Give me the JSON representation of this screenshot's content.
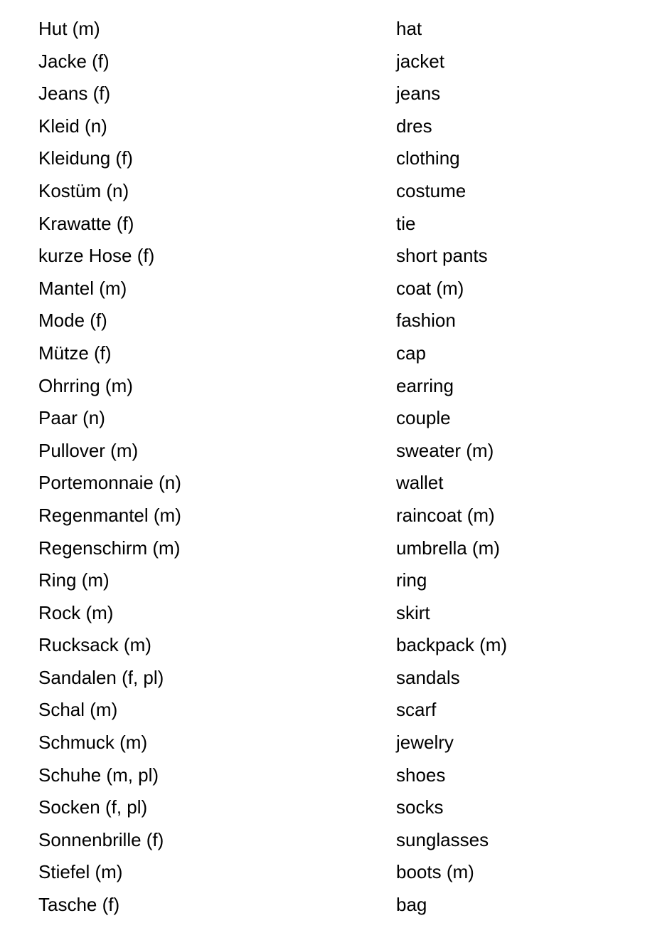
{
  "document": {
    "kind": "vocabulary-list",
    "source_language": "German",
    "target_language": "English",
    "topic": "Kleidung / Clothing",
    "row_count": 28,
    "text_color": "#000000",
    "background_color": "#ffffff"
  },
  "columns": [
    {
      "key": "term",
      "header": ""
    },
    {
      "key": "translation",
      "header": ""
    }
  ],
  "rows": [
    {
      "term": "Hut (m)",
      "translation": "hat"
    },
    {
      "term": "Jacke (f)",
      "translation": "jacket"
    },
    {
      "term": "Jeans (f)",
      "translation": "jeans"
    },
    {
      "term": "Kleid (n)",
      "translation": "dres"
    },
    {
      "term": "Kleidung (f)",
      "translation": "clothing"
    },
    {
      "term": "Kostüm (n)",
      "translation": "costume"
    },
    {
      "term": "Krawatte (f)",
      "translation": "tie"
    },
    {
      "term": "kurze Hose (f)",
      "translation": "short pants"
    },
    {
      "term": "Mantel (m)",
      "translation": "coat (m)"
    },
    {
      "term": "Mode (f)",
      "translation": "fashion"
    },
    {
      "term": "Mütze (f)",
      "translation": "cap"
    },
    {
      "term": "Ohrring (m)",
      "translation": "earring"
    },
    {
      "term": "Paar (n)",
      "translation": "couple"
    },
    {
      "term": "Pullover (m)",
      "translation": "sweater (m)"
    },
    {
      "term": "Portemonnaie (n)",
      "translation": "wallet"
    },
    {
      "term": "Regenmantel (m)",
      "translation": "raincoat (m)"
    },
    {
      "term": "Regenschirm (m)",
      "translation": "umbrella (m)"
    },
    {
      "term": "Ring (m)",
      "translation": "ring"
    },
    {
      "term": "Rock (m)",
      "translation": "skirt"
    },
    {
      "term": "Rucksack (m)",
      "translation": "backpack (m)"
    },
    {
      "term": "Sandalen (f, pl)",
      "translation": "sandals"
    },
    {
      "term": "Schal (m)",
      "translation": "scarf"
    },
    {
      "term": "Schmuck (m)",
      "translation": "jewelry"
    },
    {
      "term": "Schuhe (m, pl)",
      "translation": "shoes"
    },
    {
      "term": "Socken (f, pl)",
      "translation": "socks"
    },
    {
      "term": "Sonnenbrille (f)",
      "translation": "sunglasses"
    },
    {
      "term": "Stiefel (m)",
      "translation": "boots (m)"
    },
    {
      "term": "Tasche (f)",
      "translation": "bag"
    }
  ]
}
